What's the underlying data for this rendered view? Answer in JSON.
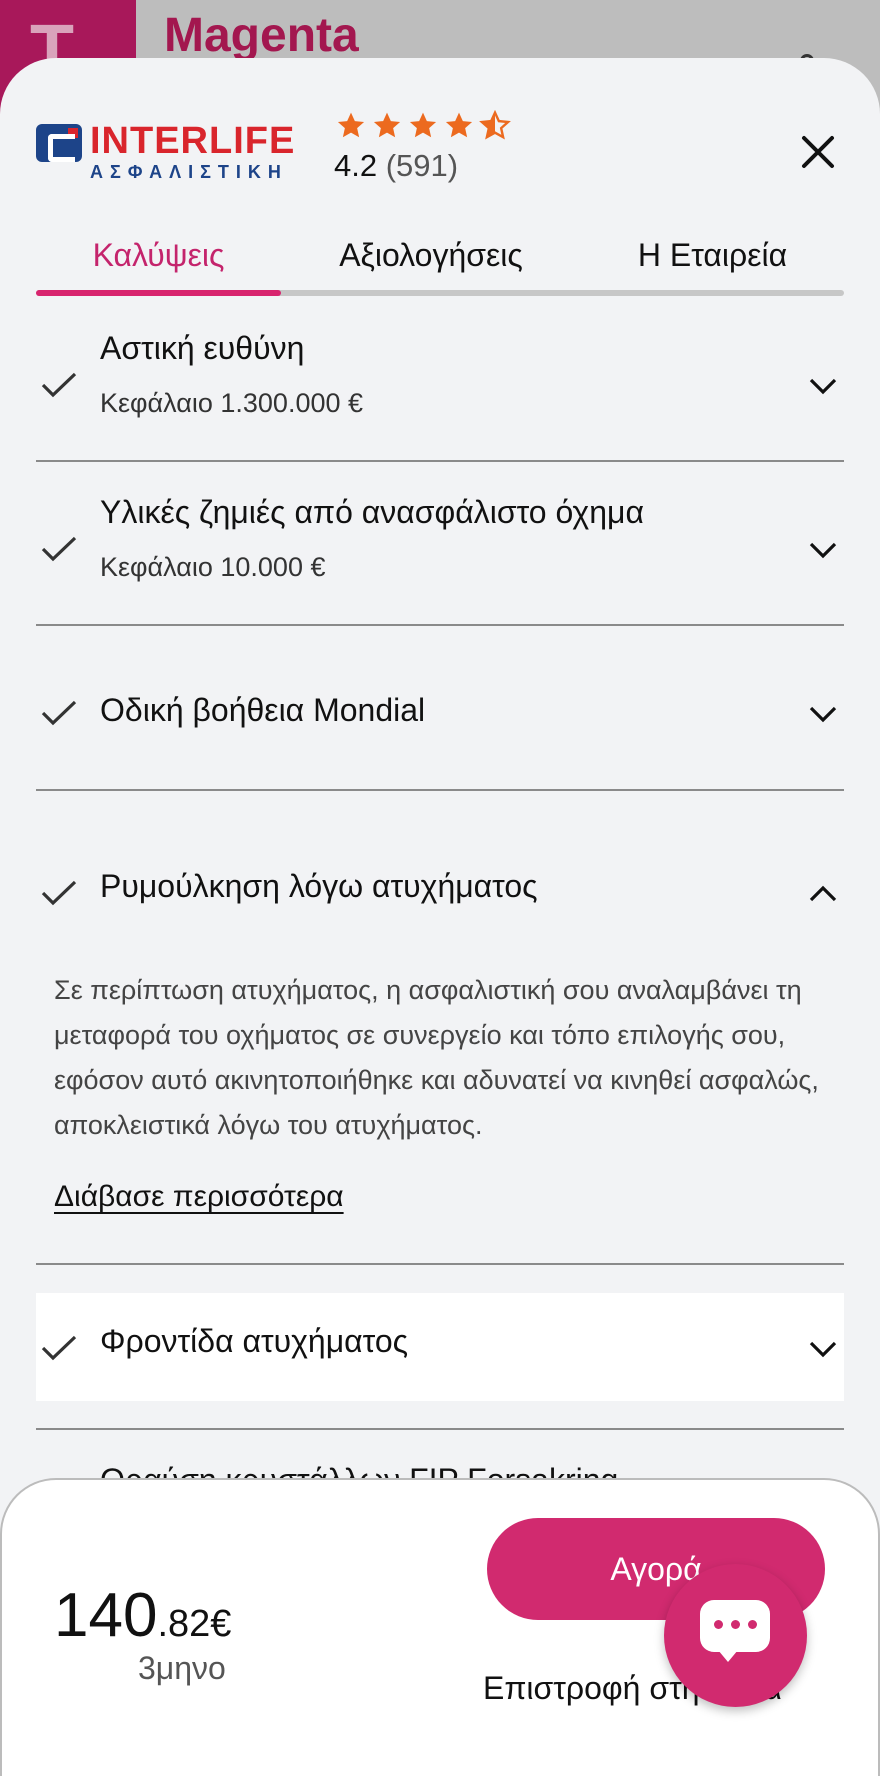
{
  "background": {
    "app_title": "Magenta",
    "logo_letter": "T"
  },
  "insurer": {
    "name": "INTERLIFE",
    "subtitle": "ΑΣΦΑΛΙΣΤΙΚΗ",
    "rating_score": "4.2",
    "rating_count": "(591)",
    "stars": 4.5
  },
  "tabs": [
    {
      "label": "Καλύψεις",
      "active": true
    },
    {
      "label": "Αξιολογήσεις",
      "active": false
    },
    {
      "label": "Η Εταιρεία",
      "active": false
    }
  ],
  "coverages": [
    {
      "title": "Αστική ευθύνη",
      "subtitle": "Κεφάλαιο 1.300.000 €",
      "expanded": false
    },
    {
      "title": "Υλικές ζημιές από ανασφάλιστο όχημα",
      "subtitle": "Κεφάλαιο 10.000 €",
      "expanded": false
    },
    {
      "title": "Οδική βοήθεια Mondial",
      "expanded": false
    },
    {
      "title": "Ρυμούλκηση λόγω ατυχήματος",
      "expanded": true,
      "description": "Σε περίπτωση ατυχήματος, η ασφαλιστική σου αναλαμβάνει τη μεταφορά του οχήματος σε συνεργείο και τόπο επιλογής σου, εφόσον αυτό ακινητοποιήθηκε και αδυνατεί να κινηθεί ασφαλώς, αποκλειστικά λόγω του ατυχήματος.",
      "read_more": "Διάβασε περισσότερα"
    },
    {
      "title": "Φροντίδα ατυχήματος",
      "expanded": false
    },
    {
      "title": "Θραύση κρυστάλλων FIP Forsakring",
      "expanded": false
    }
  ],
  "footer": {
    "price_main": "140",
    "price_cents": ".82€",
    "period": "3μηνο",
    "buy_label": "Αγορά",
    "back_label": "Επιστροφή στη λίστα"
  },
  "colors": {
    "accent": "#d12a6f",
    "tab_active": "#c4246c",
    "star": "#ec6a1f",
    "brand_red": "#d9252c",
    "brand_blue": "#1d4489"
  }
}
